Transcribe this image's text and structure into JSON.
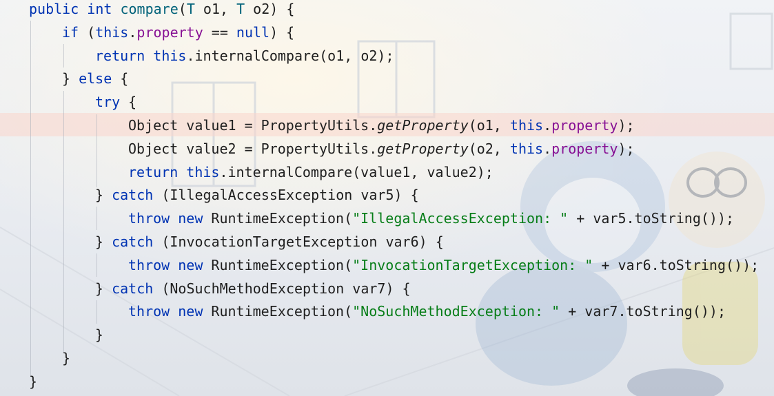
{
  "editor": {
    "colors": {
      "keyword": "#0033b3",
      "method_declaration": "#00627a",
      "field": "#871094",
      "string": "#067d17",
      "plain": "#1f1f1f",
      "caret_line": "#fad6cc"
    },
    "lines": [
      {
        "indent": 0,
        "tokens": [
          {
            "text": "public",
            "kind": "kw"
          },
          {
            "text": " "
          },
          {
            "text": "int",
            "kind": "kw"
          },
          {
            "text": " "
          },
          {
            "text": "compare",
            "kind": "fn"
          },
          {
            "text": "("
          },
          {
            "text": "T",
            "kind": "tp"
          },
          {
            "text": " o1, "
          },
          {
            "text": "T",
            "kind": "tp"
          },
          {
            "text": " o2) {"
          }
        ]
      },
      {
        "indent": 1,
        "tokens": [
          {
            "text": "if",
            "kind": "kw"
          },
          {
            "text": " ("
          },
          {
            "text": "this",
            "kind": "kw"
          },
          {
            "text": "."
          },
          {
            "text": "property",
            "kind": "field"
          },
          {
            "text": " == "
          },
          {
            "text": "null",
            "kind": "kw"
          },
          {
            "text": ") {"
          }
        ]
      },
      {
        "indent": 2,
        "tokens": [
          {
            "text": "return",
            "kind": "kw"
          },
          {
            "text": " "
          },
          {
            "text": "this",
            "kind": "kw"
          },
          {
            "text": ".internalCompare(o1, o2);"
          }
        ]
      },
      {
        "indent": 1,
        "tokens": [
          {
            "text": "} "
          },
          {
            "text": "else",
            "kind": "kw"
          },
          {
            "text": " {"
          }
        ]
      },
      {
        "indent": 2,
        "tokens": [
          {
            "text": "try",
            "kind": "kw"
          },
          {
            "text": " {"
          }
        ]
      },
      {
        "indent": 3,
        "tokens": [
          {
            "text": "Object value1 = PropertyUtils."
          },
          {
            "text": "getProperty",
            "kind": "it"
          },
          {
            "text": "(o1, "
          },
          {
            "text": "this",
            "kind": "kw"
          },
          {
            "text": "."
          },
          {
            "text": "property",
            "kind": "field"
          },
          {
            "text": ");"
          }
        ]
      },
      {
        "indent": 3,
        "tokens": [
          {
            "text": "Object value2 = PropertyUtils."
          },
          {
            "text": "getProperty",
            "kind": "it"
          },
          {
            "text": "(o2, "
          },
          {
            "text": "this",
            "kind": "kw"
          },
          {
            "text": "."
          },
          {
            "text": "property",
            "kind": "field"
          },
          {
            "text": ");"
          }
        ]
      },
      {
        "indent": 3,
        "tokens": [
          {
            "text": "return",
            "kind": "kw"
          },
          {
            "text": " "
          },
          {
            "text": "this",
            "kind": "kw"
          },
          {
            "text": ".internalCompare(value1, value2);"
          }
        ]
      },
      {
        "indent": 2,
        "tokens": [
          {
            "text": "} "
          },
          {
            "text": "catch",
            "kind": "kw"
          },
          {
            "text": " (IllegalAccessException var5) {"
          }
        ]
      },
      {
        "indent": 3,
        "tokens": [
          {
            "text": "throw",
            "kind": "kw"
          },
          {
            "text": " "
          },
          {
            "text": "new",
            "kind": "kw"
          },
          {
            "text": " RuntimeException("
          },
          {
            "text": "\"IllegalAccessException: \"",
            "kind": "str"
          },
          {
            "text": " + var5.toString());"
          }
        ]
      },
      {
        "indent": 2,
        "tokens": [
          {
            "text": "} "
          },
          {
            "text": "catch",
            "kind": "kw"
          },
          {
            "text": " (InvocationTargetException var6) {"
          }
        ]
      },
      {
        "indent": 3,
        "tokens": [
          {
            "text": "throw",
            "kind": "kw"
          },
          {
            "text": " "
          },
          {
            "text": "new",
            "kind": "kw"
          },
          {
            "text": " RuntimeException("
          },
          {
            "text": "\"InvocationTargetException: \"",
            "kind": "str"
          },
          {
            "text": " + var6.toString());"
          }
        ]
      },
      {
        "indent": 2,
        "tokens": [
          {
            "text": "} "
          },
          {
            "text": "catch",
            "kind": "kw"
          },
          {
            "text": " (NoSuchMethodException var7) {"
          }
        ]
      },
      {
        "indent": 3,
        "tokens": [
          {
            "text": "throw",
            "kind": "kw"
          },
          {
            "text": " "
          },
          {
            "text": "new",
            "kind": "kw"
          },
          {
            "text": " RuntimeException("
          },
          {
            "text": "\"NoSuchMethodException: \"",
            "kind": "str"
          },
          {
            "text": " + var7.toString());"
          }
        ]
      },
      {
        "indent": 2,
        "tokens": [
          {
            "text": "}"
          }
        ]
      },
      {
        "indent": 1,
        "tokens": [
          {
            "text": "}"
          }
        ]
      },
      {
        "indent": 0,
        "tokens": [
          {
            "text": "}"
          }
        ]
      }
    ]
  }
}
